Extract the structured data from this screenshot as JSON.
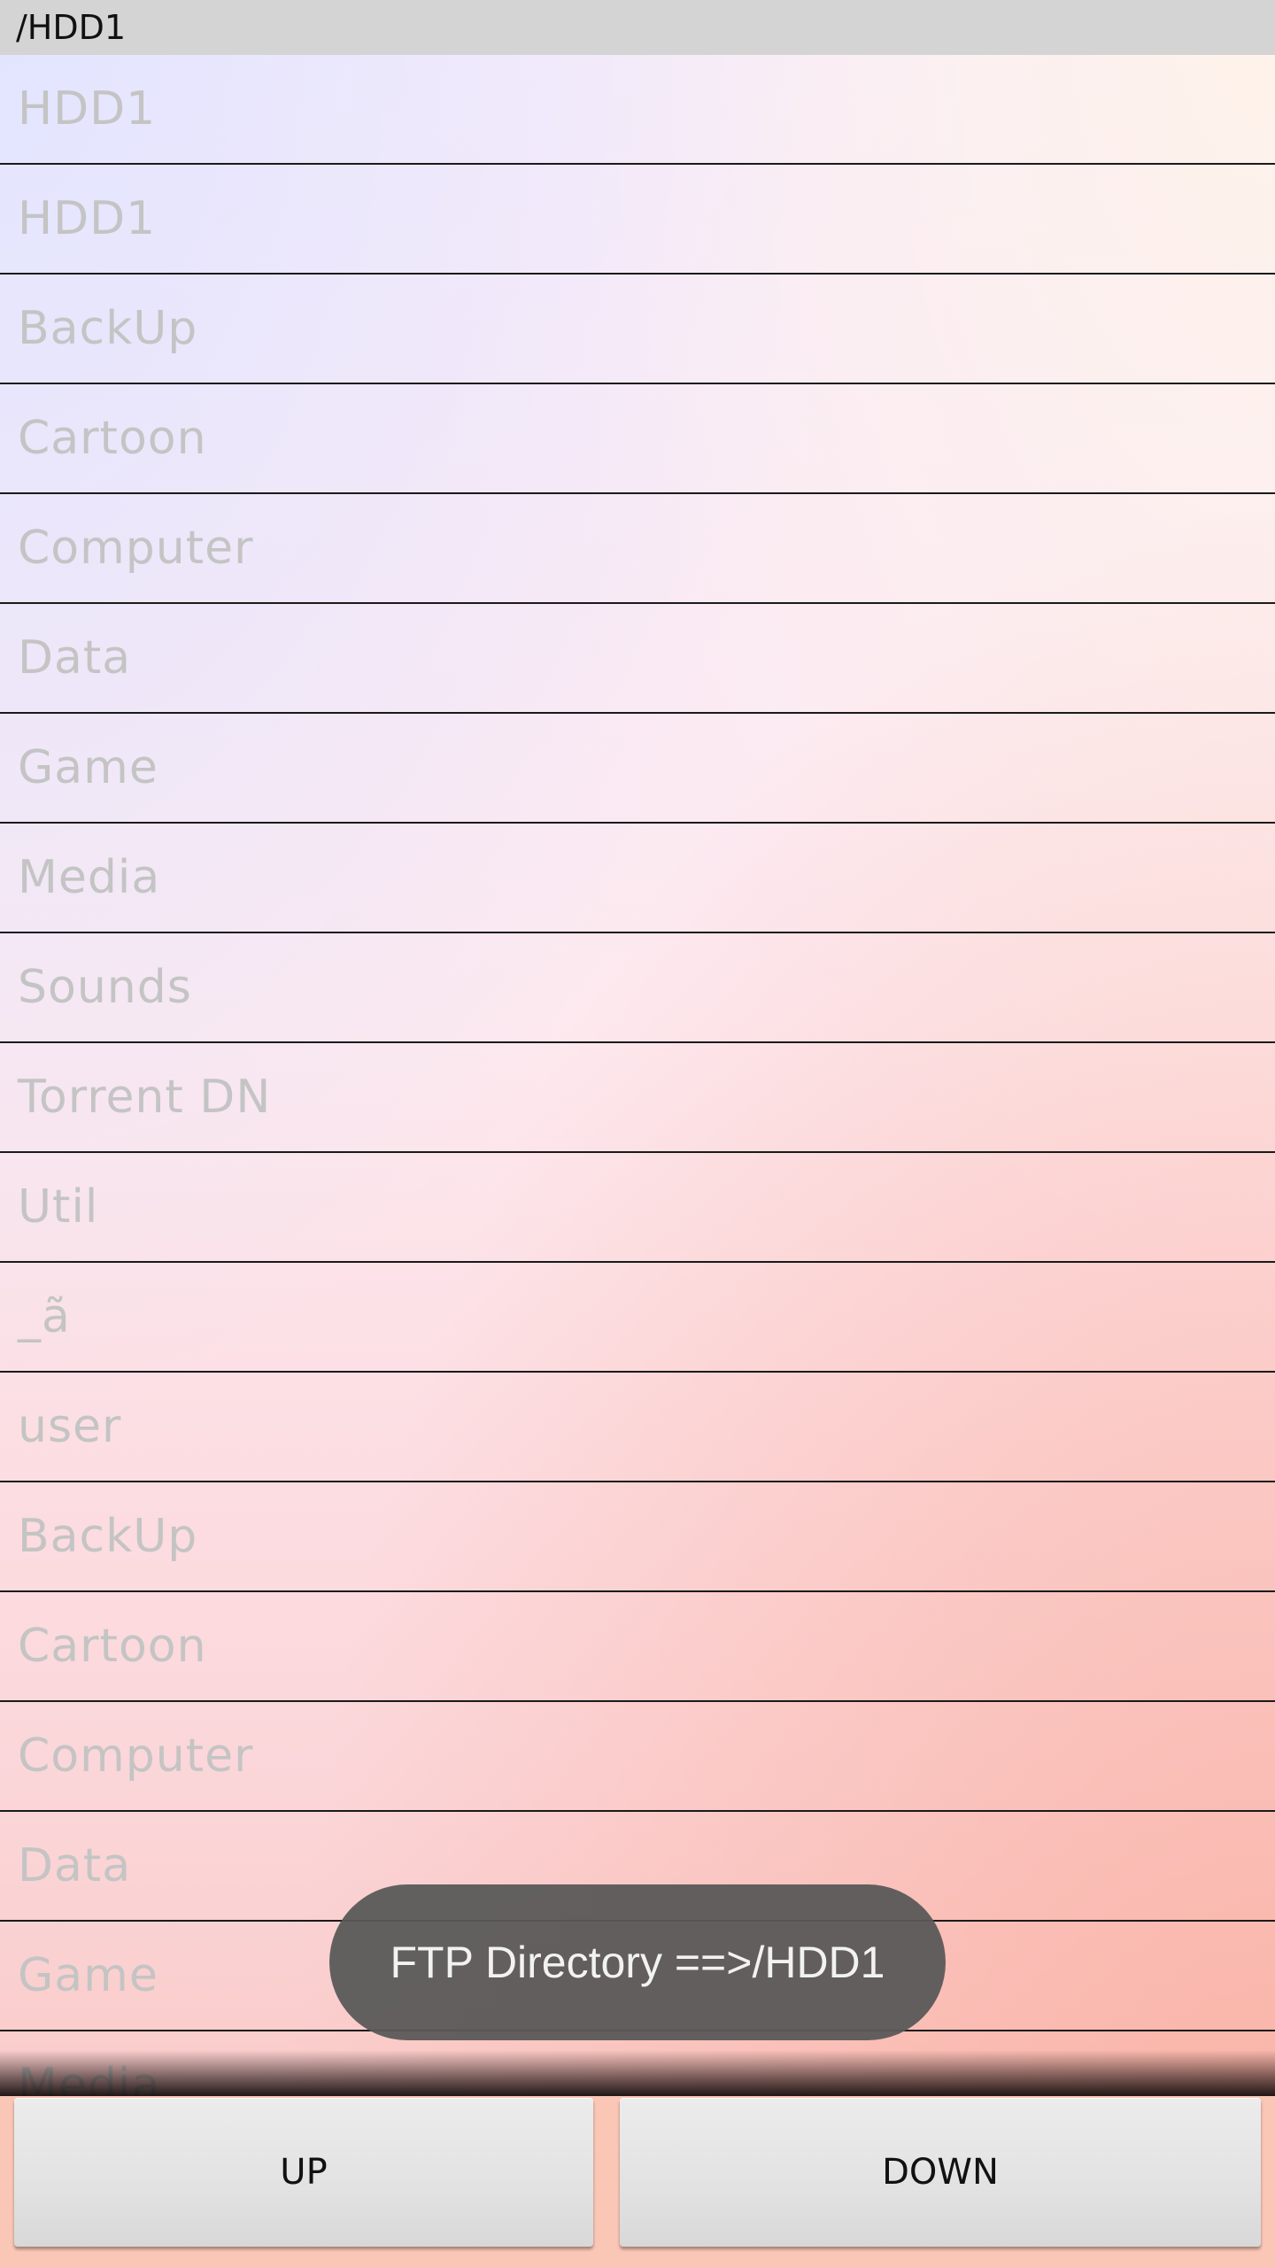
{
  "path_bar": {
    "path": "/HDD1"
  },
  "file_list": {
    "items": [
      "HDD1",
      "HDD1",
      "BackUp",
      "Cartoon",
      "Computer",
      "Data",
      "Game",
      "Media",
      "Sounds",
      "Torrent DN",
      "Util",
      "_ã",
      "user",
      "BackUp",
      "Cartoon",
      "Computer",
      "Data",
      "Game",
      "Media"
    ]
  },
  "toast": {
    "message": "FTP Directory ==>/HDD1"
  },
  "buttons": {
    "up_label": "UP",
    "down_label": "DOWN"
  }
}
